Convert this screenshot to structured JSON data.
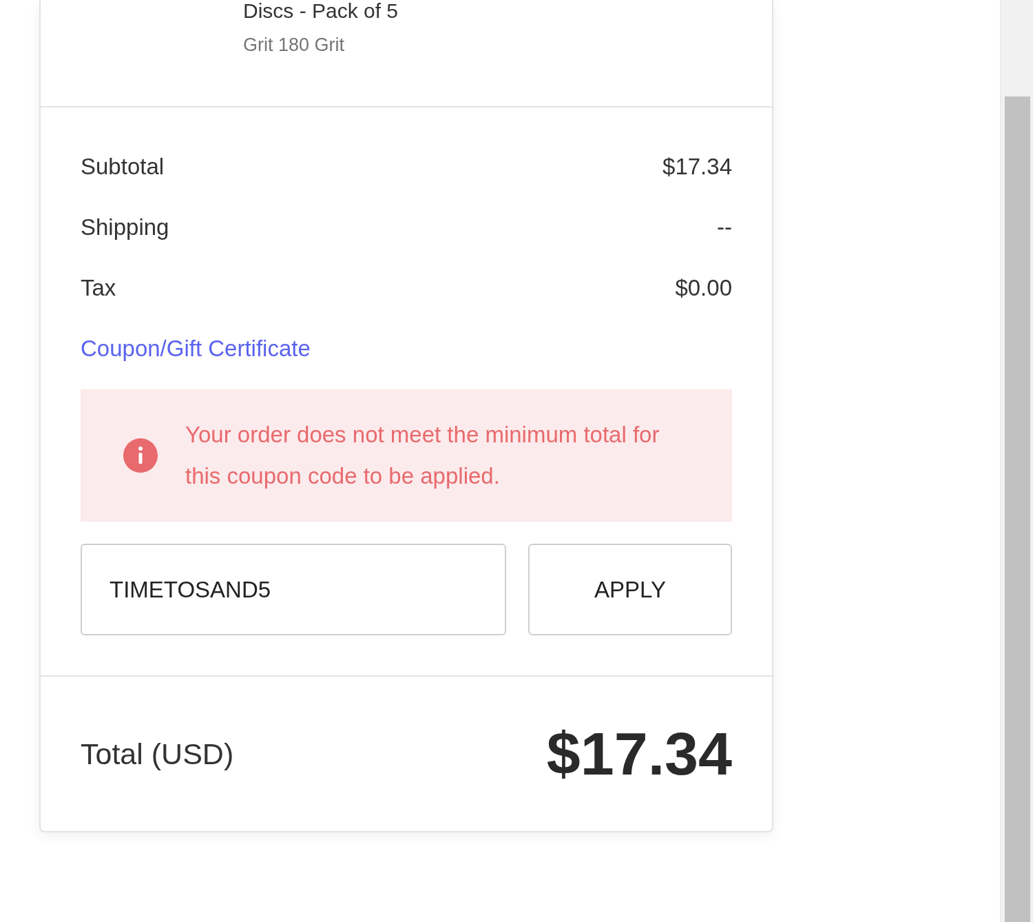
{
  "product": {
    "name": "Discs - Pack of 5",
    "variant": "Grit 180 Grit"
  },
  "summary_rows": [
    {
      "label": "Subtotal",
      "value": "$17.34"
    },
    {
      "label": "Shipping",
      "value": "--"
    },
    {
      "label": "Tax",
      "value": "$0.00"
    }
  ],
  "coupon": {
    "link": "Coupon/Gift Certificate",
    "alert": {
      "kind": "error",
      "message": "Your order does not meet the minimum total for this coupon code to be applied."
    },
    "code_field": {
      "value": "TIMETOSAND5"
    },
    "apply_button": "APPLY"
  },
  "total": {
    "label": "Total (USD)",
    "value": "$17.34"
  }
}
